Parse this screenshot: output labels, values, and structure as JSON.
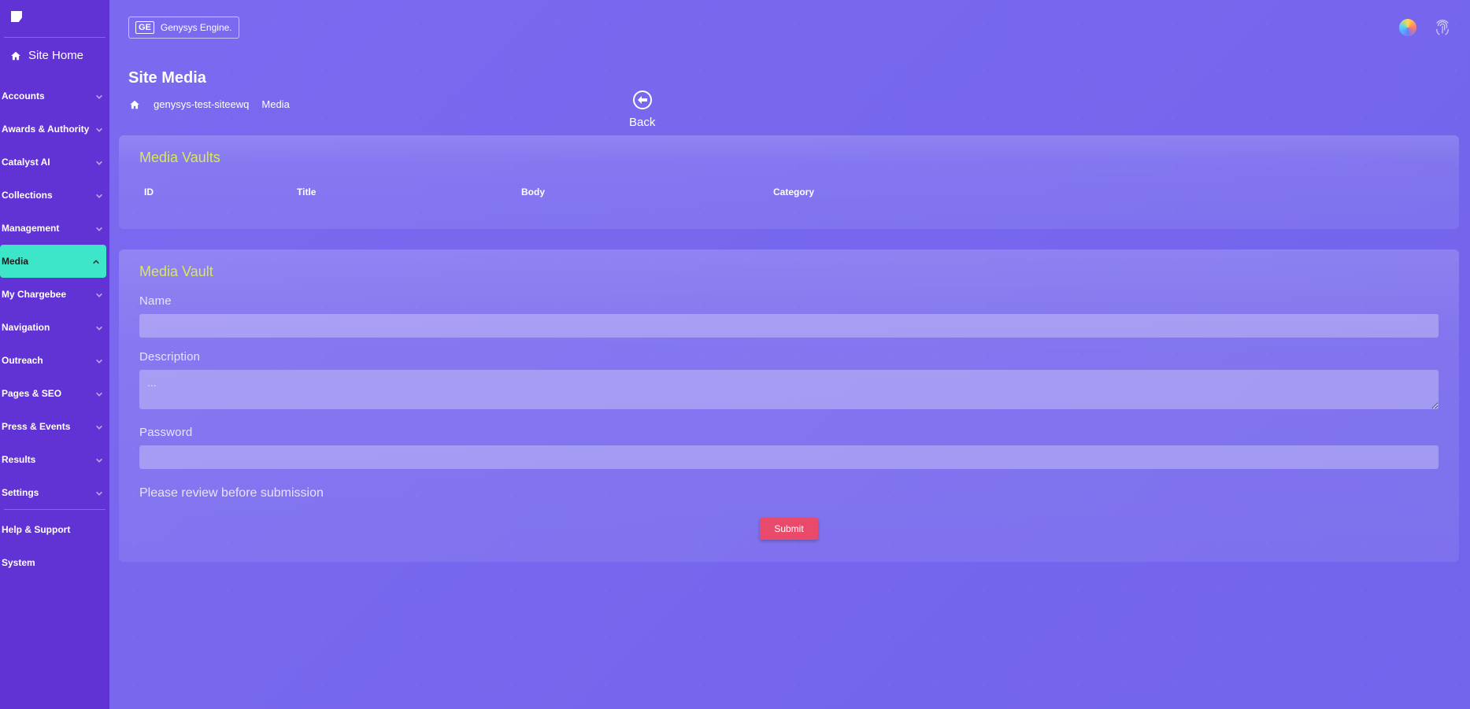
{
  "sidebar": {
    "site_home": "Site Home",
    "items": [
      {
        "label": "Accounts"
      },
      {
        "label": "Awards & Authority"
      },
      {
        "label": "Catalyst AI"
      },
      {
        "label": "Collections"
      },
      {
        "label": "Management"
      },
      {
        "label": "Media"
      },
      {
        "label": "My Chargebee"
      },
      {
        "label": "Navigation"
      },
      {
        "label": "Outreach"
      },
      {
        "label": "Pages & SEO"
      },
      {
        "label": "Press & Events"
      },
      {
        "label": "Results"
      },
      {
        "label": "Settings"
      }
    ],
    "bottom": [
      {
        "label": "Help & Support"
      },
      {
        "label": "System"
      }
    ]
  },
  "header": {
    "brand": "Genysys Engine."
  },
  "page": {
    "title": "Site Media",
    "breadcrumb_site": "genysys-test-siteewq",
    "breadcrumb_current": "Media",
    "back_label": "Back"
  },
  "vaults_card": {
    "title": "Media Vaults",
    "columns": {
      "id": "ID",
      "title": "Title",
      "body": "Body",
      "category": "Category"
    }
  },
  "form_card": {
    "title": "Media Vault",
    "name_label": "Name",
    "name_value": "",
    "description_label": "Description",
    "description_placeholder": "...",
    "description_value": "",
    "password_label": "Password",
    "password_value": "",
    "review_text": "Please review before submission",
    "submit_label": "Submit"
  }
}
